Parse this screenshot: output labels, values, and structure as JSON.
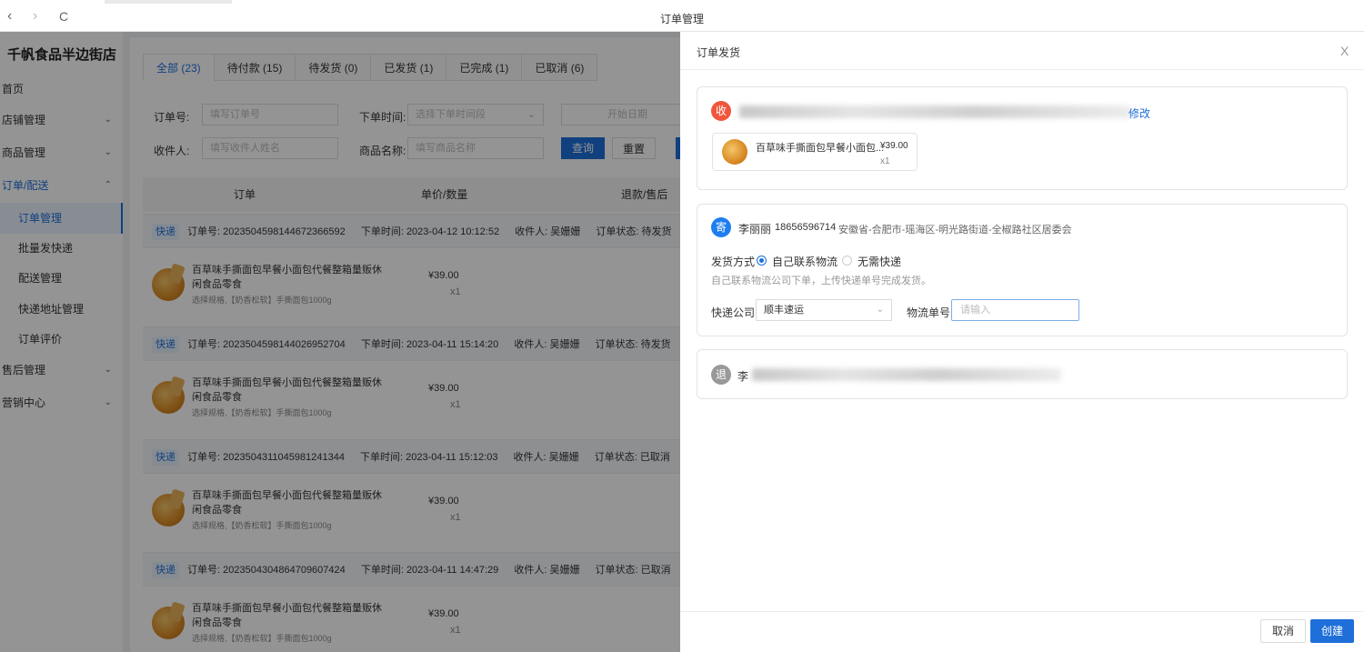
{
  "browser": {
    "title": "订单管理",
    "back": "‹",
    "forward": "›",
    "reload": "C"
  },
  "sidebar": {
    "brand": "千帆食品半边街店",
    "items": [
      {
        "label": "首页"
      },
      {
        "label": "店铺管理"
      },
      {
        "label": "商品管理"
      },
      {
        "label": "订单/配送"
      },
      {
        "label": "订单管理"
      },
      {
        "label": "批量发快递"
      },
      {
        "label": "配送管理"
      },
      {
        "label": "快递地址管理"
      },
      {
        "label": "订单评价"
      },
      {
        "label": "售后管理"
      },
      {
        "label": "营销中心"
      }
    ]
  },
  "tabs": [
    "全部 (23)",
    "待付款 (15)",
    "待发货 (0)",
    "已发货 (1)",
    "已完成 (1)",
    "已取消 (6)"
  ],
  "filters": {
    "order_no_label": "订单号:",
    "order_no_placeholder": "填写订单号",
    "time_label": "下单时间:",
    "time_placeholder": "选择下单时间段",
    "start_date": "开始日期",
    "receiver_label": "收件人:",
    "receiver_placeholder": "填写收件人姓名",
    "product_label": "商品名称:",
    "product_placeholder": "填写商品名称",
    "query": "查询",
    "reset": "重置"
  },
  "table": {
    "headers": [
      "订单",
      "单价/数量",
      "退款/售后"
    ]
  },
  "orders": [
    {
      "badge": "快递",
      "order_no": "订单号: 2023504598144672366592",
      "time": "下单时间: 2023-04-12 10:12:52",
      "receiver": "收件人: 吴姗姗",
      "status": "订单状态: 待发货",
      "product": "百草味手撕面包早餐小面包代餐整箱量贩休闲食品零食",
      "spec": "选择规格,【奶香松软】手撕面包1000g",
      "price": "¥39.00",
      "qty": "x1"
    },
    {
      "badge": "快递",
      "order_no": "订单号: 2023504598144026952704",
      "time": "下单时间: 2023-04-11 15:14:20",
      "receiver": "收件人: 吴姗姗",
      "status": "订单状态: 待发货",
      "product": "百草味手撕面包早餐小面包代餐整箱量贩休闲食品零食",
      "spec": "选择规格,【奶香松软】手撕面包1000g",
      "price": "¥39.00",
      "qty": "x1"
    },
    {
      "badge": "快递",
      "order_no": "订单号: 2023504311045981241344",
      "time": "下单时间: 2023-04-11 15:12:03",
      "receiver": "收件人: 吴姗姗",
      "status": "订单状态: 已取消",
      "product": "百草味手撕面包早餐小面包代餐整箱量贩休闲食品零食",
      "spec": "选择规格,【奶香松软】手撕面包1000g",
      "price": "¥39.00",
      "qty": "x1"
    },
    {
      "badge": "快递",
      "order_no": "订单号: 2023504304864709607424",
      "time": "下单时间: 2023-04-11 14:47:29",
      "receiver": "收件人: 吴姗姗",
      "status": "订单状态: 已取消",
      "product": "百草味手撕面包早餐小面包代餐整箱量贩休闲食品零食",
      "spec": "选择规格,【奶香松软】手撕面包1000g",
      "price": "¥39.00",
      "qty": "x1"
    }
  ],
  "drawer": {
    "title": "订单发货",
    "close": "X",
    "receiver": {
      "icon_char": "收",
      "modify": "修改",
      "product_name": "百草味手撕面包早餐小面包...",
      "price": "¥39.00",
      "qty": "x1"
    },
    "sender": {
      "icon_char": "寄",
      "name": "李丽丽",
      "phone": "18656596714",
      "address": "安徽省-合肥市-瑶海区-明光路街道-全椒路社区居委会",
      "method_label": "发货方式",
      "option_self": "自己联系物流",
      "option_none": "无需快递",
      "hint": "自己联系物流公司下单，上传快递单号完成发货。",
      "company_label": "快递公司",
      "company_value": "顺丰速运",
      "tracking_label": "物流单号",
      "tracking_placeholder": "请输入"
    },
    "return_addr": {
      "icon_char": "退",
      "name_prefix": "李"
    },
    "cancel": "取消",
    "create": "创建"
  },
  "colors": {
    "accent": "#1e6fd9",
    "receive_icon": "#f0563c",
    "send_icon": "#1e7ef0",
    "return_icon": "#999999"
  },
  "icons": {
    "chevron": "chevron-down-icon",
    "close": "close-icon"
  }
}
